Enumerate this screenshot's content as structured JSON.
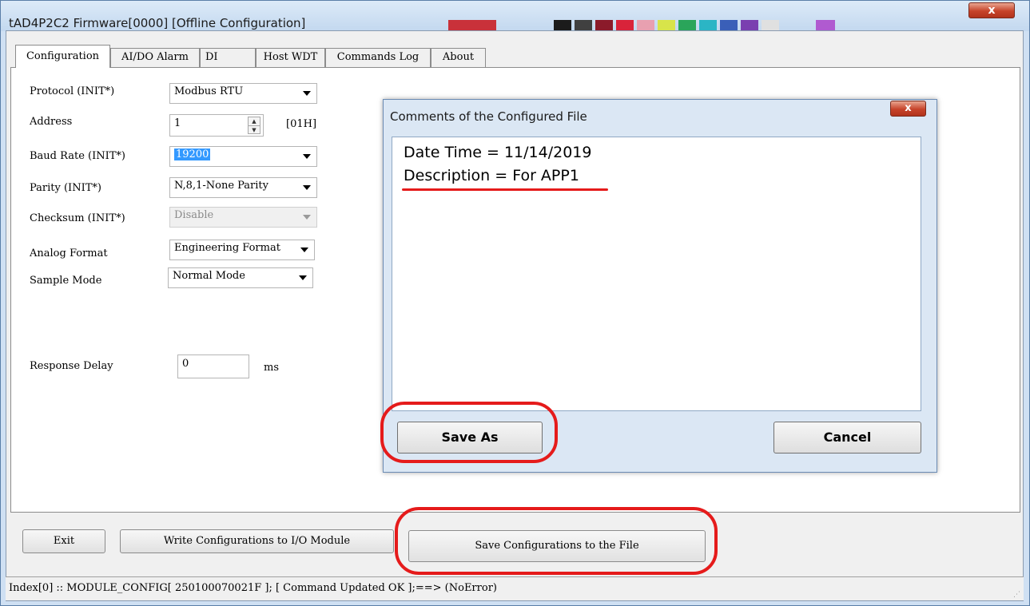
{
  "window": {
    "title": "tAD4P2C2 Firmware[0000] [Offline Configuration]",
    "close_glyph": "x"
  },
  "tabs": [
    {
      "label": "Configuration"
    },
    {
      "label": "AI/DO Alarm"
    },
    {
      "label": "DI"
    },
    {
      "label": "Host WDT"
    },
    {
      "label": "Commands Log"
    },
    {
      "label": "About"
    }
  ],
  "config": {
    "protocol": {
      "label": "Protocol (INIT*)",
      "value": "Modbus RTU"
    },
    "address": {
      "label": "Address",
      "value": "1",
      "hex": "[01H]"
    },
    "baud_rate": {
      "label": "Baud Rate (INIT*)",
      "value": "19200"
    },
    "parity": {
      "label": "Parity (INIT*)",
      "value": "N,8,1-None Parity"
    },
    "checksum": {
      "label": "Checksum (INIT*)",
      "value": "Disable"
    },
    "analog_format": {
      "label": "Analog Format",
      "value": "Engineering Format"
    },
    "sample_mode": {
      "label": "Sample Mode",
      "value": "Normal Mode"
    },
    "response_delay": {
      "label": "Response Delay",
      "value": "0",
      "unit": "ms"
    }
  },
  "dialog": {
    "title": "Comments of the Configured File",
    "close_glyph": "x",
    "lines": [
      "Date Time = 11/14/2019",
      "Description = For APP1"
    ],
    "save_as_label": "Save As",
    "cancel_label": "Cancel"
  },
  "buttons": {
    "exit": "Exit",
    "write": "Write Configurations to I/O Module",
    "save_file": "Save Configurations to the File"
  },
  "status_bar": {
    "text": "Index[0] :: MODULE_CONFIG[ 250100070021F ]; [ Command Updated OK ];==> (NoError)"
  },
  "colors": {
    "annotation": "#e51b1b",
    "selection": "#3399ff",
    "window_frame": "#cfe0f3"
  }
}
